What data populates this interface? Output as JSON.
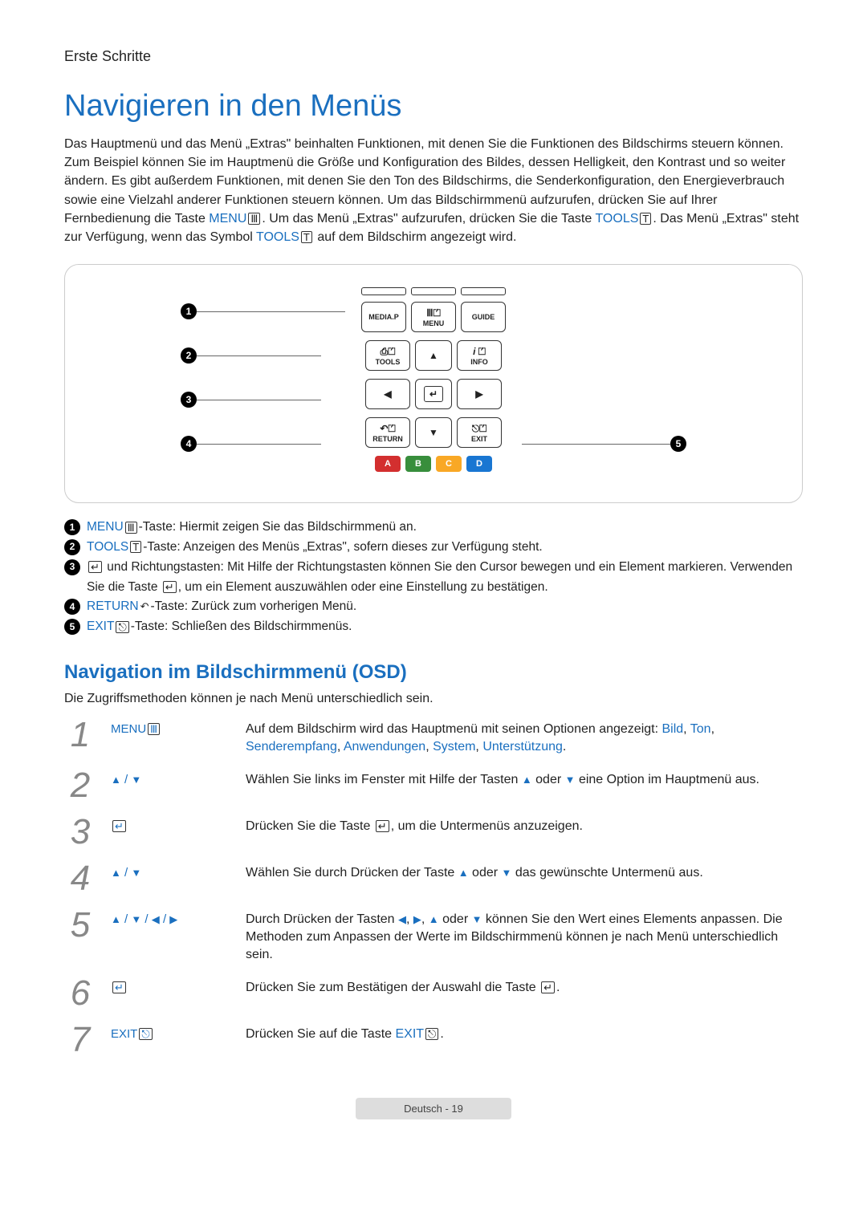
{
  "section": "Erste Schritte",
  "title": "Navigieren in den Menüs",
  "intro": {
    "p1a": "Das Hauptmenü und das Menü „Extras\" beinhalten Funktionen, mit denen Sie die Funktionen des Bildschirms steuern können. Zum Beispiel können Sie im Hauptmenü die Größe und Konfiguration des Bildes, dessen Helligkeit, den Kontrast und so weiter ändern. Es gibt außerdem Funktionen, mit denen Sie den Ton des Bildschirms, die Senderkonfiguration, den Energieverbrauch sowie eine Vielzahl anderer Funktionen steuern können. Um das Bildschirmmenü aufzurufen, drücken Sie auf Ihrer Fernbedienung die Taste ",
    "menu_label": "MENU",
    "p1b": ". Um das Menü „Extras\" aufzurufen, drücken Sie die Taste ",
    "tools_label": "TOOLS",
    "p1c": ". Das Menü „Extras\" steht zur Verfügung, wenn das Symbol ",
    "p1d": " auf dem Bildschirm angezeigt wird."
  },
  "remote": {
    "media_p": "MEDIA.P",
    "menu": "MENU",
    "guide": "GUIDE",
    "tools": "TOOLS",
    "info": "INFO",
    "return": "RETURN",
    "exit": "EXIT",
    "a": "A",
    "b": "B",
    "c": "C",
    "d": "D"
  },
  "legend": {
    "l1_key": "MENU",
    "l1_text": "-Taste: Hiermit zeigen Sie das Bildschirmmenü an.",
    "l2_key": "TOOLS",
    "l2_text": "-Taste: Anzeigen des Menüs „Extras\", sofern dieses zur Verfügung steht.",
    "l3_a": " und Richtungstasten: Mit Hilfe der Richtungstasten können Sie den Cursor bewegen und ein Element markieren. Verwenden Sie die Taste ",
    "l3_b": ", um ein Element auszuwählen oder eine Einstellung zu bestätigen.",
    "l4_key": "RETURN",
    "l4_text": "-Taste: Zurück zum vorherigen Menü.",
    "l5_key": "EXIT",
    "l5_text": "-Taste: Schließen des Bildschirmmenüs."
  },
  "osd": {
    "heading": "Navigation im Bildschirmmenü (OSD)",
    "intro": "Die Zugriffsmethoden können je nach Menü unterschiedlich sein.",
    "steps": {
      "s1_icon": "MENU",
      "s1_text_a": "Auf dem Bildschirm wird das Hauptmenü mit seinen Optionen angezeigt: ",
      "s1_opts": [
        "Bild",
        "Ton",
        "Senderempfang",
        "Anwendungen",
        "System",
        "Unterstützung"
      ],
      "s2_text_a": "Wählen Sie links im Fenster mit Hilfe der Tasten ",
      "s2_text_b": " oder ",
      "s2_text_c": " eine Option im Hauptmenü aus.",
      "s3_text_a": "Drücken Sie die Taste ",
      "s3_text_b": ", um die Untermenüs anzuzeigen.",
      "s4_text_a": "Wählen Sie durch Drücken der Taste ",
      "s4_text_b": " oder ",
      "s4_text_c": " das gewünschte Untermenü aus.",
      "s5_text_a": "Durch Drücken der Tasten ",
      "s5_text_b": " oder ",
      "s5_text_c": " können Sie den Wert eines Elements anpassen. Die Methoden zum Anpassen der Werte im Bildschirmmenü können je nach Menü unterschiedlich sein.",
      "s6_text_a": "Drücken Sie zum Bestätigen der Auswahl die Taste ",
      "s7_icon": "EXIT",
      "s7_text_a": "Drücken Sie auf die Taste ",
      "s7_key": "EXIT"
    }
  },
  "footer": "Deutsch - 19"
}
